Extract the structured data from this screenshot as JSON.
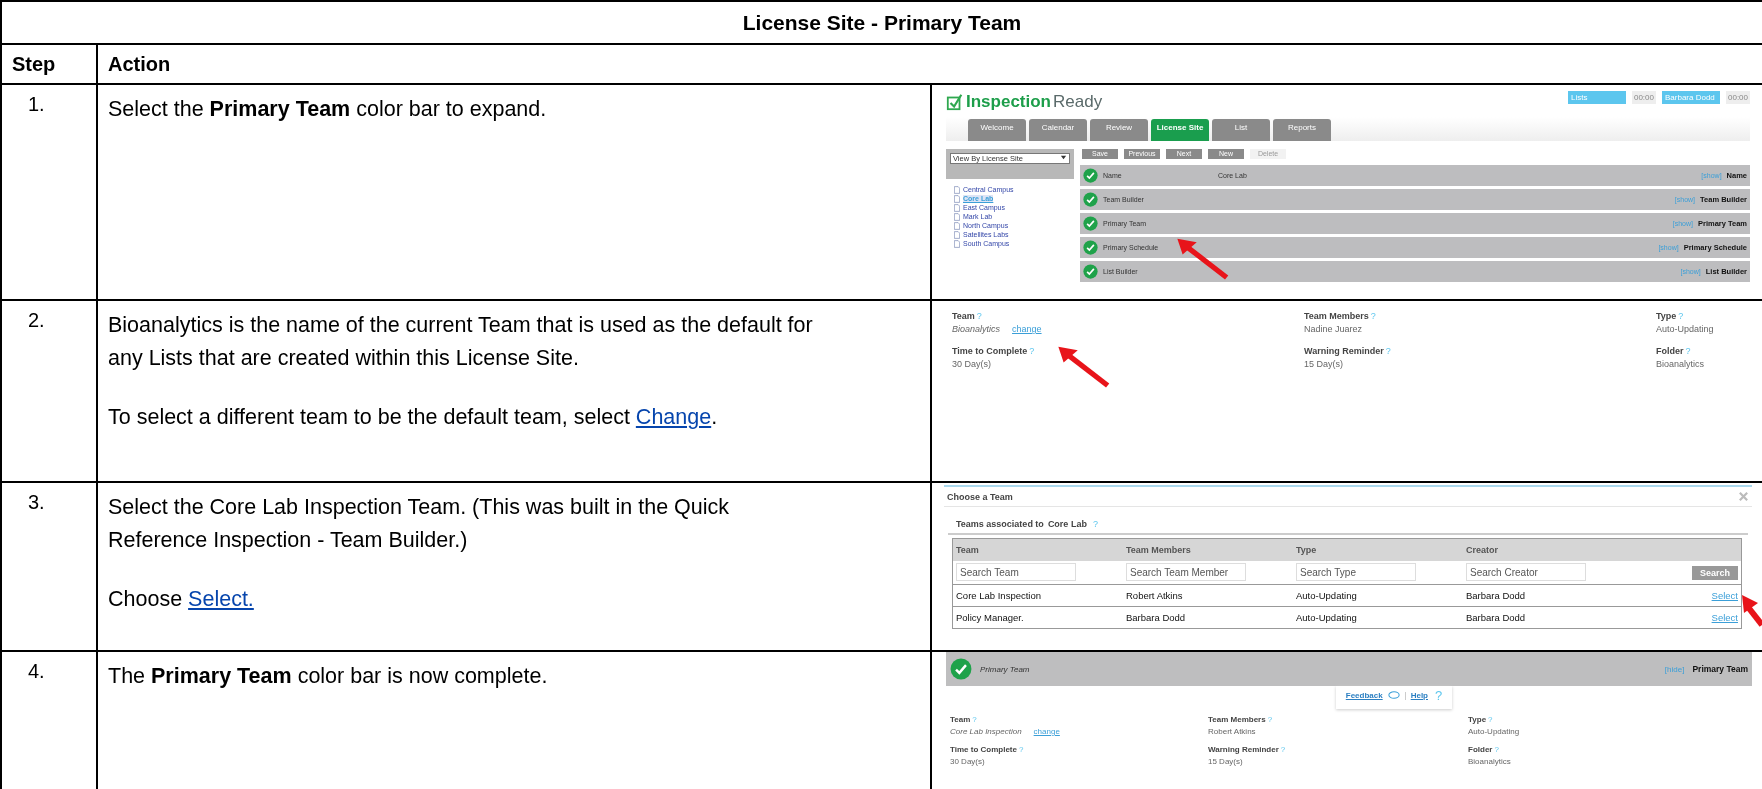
{
  "title": "License Site - Primary Team",
  "columns": [
    "Step",
    "Action"
  ],
  "steps": [
    {
      "number": "1.",
      "paragraphs": [
        {
          "text": "Select the **Primary Team** color bar to expand."
        }
      ],
      "screenshot": {
        "kind": "app",
        "logo_bold": "Inspection",
        "logo_light": "Ready",
        "top_pills": [
          {
            "label": "Lists",
            "time": "00:00"
          },
          {
            "label": "Barbara Dodd",
            "time": "00:00"
          }
        ],
        "tabs": [
          {
            "label": "Welcome",
            "selected": false
          },
          {
            "label": "Calendar",
            "selected": false
          },
          {
            "label": "Review",
            "selected": false
          },
          {
            "label": "License Site",
            "selected": true
          },
          {
            "label": "List",
            "selected": false
          },
          {
            "label": "Reports",
            "selected": false
          }
        ],
        "view_select": "View By License Site",
        "tree": [
          {
            "label": "Central Campus",
            "selected": false
          },
          {
            "label": "Core Lab",
            "selected": true
          },
          {
            "label": "East Campus",
            "selected": false
          },
          {
            "label": "Mark Lab",
            "selected": false
          },
          {
            "label": "North Campus",
            "selected": false
          },
          {
            "label": "Satellites Labs",
            "selected": false
          },
          {
            "label": "South Campus",
            "selected": false
          }
        ],
        "toolbar": [
          {
            "label": "Save",
            "disabled": false
          },
          {
            "label": "Previous",
            "disabled": false
          },
          {
            "label": "Next",
            "disabled": false
          },
          {
            "label": "New",
            "disabled": false
          },
          {
            "label": "Delete",
            "disabled": true
          }
        ],
        "bars": [
          {
            "label": "Name",
            "value": "Core Lab",
            "toggle": "[show]",
            "title": "Name"
          },
          {
            "label": "Team Builder",
            "toggle": "[show]",
            "title": "Team Builder"
          },
          {
            "label": "Primary Team",
            "toggle": "[show]",
            "title": "Primary Team"
          },
          {
            "label": "Primary Schedule",
            "toggle": "[show]",
            "title": "Primary Schedule"
          },
          {
            "label": "List Builder",
            "toggle": "[show]",
            "title": "List Builder"
          }
        ]
      }
    },
    {
      "number": "2.",
      "paragraphs": [
        {
          "text": "Bioanalytics is the name of the current Team that is used as the default for any Lists that are created within this License Site."
        },
        {
          "text": "To select a different team to be the default team, select ",
          "link": "Change",
          "after": "."
        }
      ],
      "screenshot": {
        "kind": "details",
        "fields": [
          {
            "label": "Team",
            "hint": "?",
            "value": "Bioanalytics",
            "link": "change"
          },
          {
            "label": "Team Members",
            "hint": "?",
            "value": "Nadine Juarez"
          },
          {
            "label": "Type",
            "hint": "?",
            "value": "Auto-Updating"
          },
          {
            "label": "Time to Complete",
            "hint": "?",
            "value": "30 Day(s)"
          },
          {
            "label": "Warning Reminder",
            "hint": "?",
            "value": "15 Day(s)"
          },
          {
            "label": "Folder",
            "hint": "?",
            "value": "Bioanalytics"
          }
        ]
      }
    },
    {
      "number": "3.",
      "paragraphs": [
        {
          "text": "Select the Core Lab Inspection Team.  (This was built in the Quick Reference Inspection - Team Builder.)"
        },
        {
          "text": "Choose ",
          "link": "Select."
        }
      ],
      "screenshot": {
        "kind": "chooser",
        "title": "Choose a Team",
        "subtitle": "Teams associated to",
        "site": "Core Lab",
        "hint": "?",
        "columns": [
          "Team",
          "Team Members",
          "Type",
          "Creator"
        ],
        "searches": [
          {
            "placeholder": "Search Team"
          },
          {
            "placeholder": "Search Team Member"
          },
          {
            "placeholder": "Search Type"
          },
          {
            "placeholder": "Search Creator"
          }
        ],
        "search_button": "Search",
        "rows": [
          {
            "cells": [
              "Core Lab Inspection",
              "Robert Atkins",
              "Auto-Updating",
              "Barbara Dodd"
            ],
            "action": "Select"
          },
          {
            "cells": [
              "Policy Manager.",
              "Barbara Dodd",
              "Auto-Updating",
              "Barbara Dodd"
            ],
            "action": "Select"
          }
        ]
      }
    },
    {
      "number": "4.",
      "paragraphs": [
        {
          "text": "The **Primary Team** color bar is now complete."
        }
      ],
      "screenshot": {
        "kind": "expanded",
        "bar_label": "Primary Team",
        "toggle": "[hide]",
        "bar_title": "Primary Team",
        "feedback": "Feedback",
        "help": "Help",
        "help_mark": "?",
        "fields": [
          {
            "label": "Team",
            "hint": "?",
            "value": "Core Lab Inspection",
            "link": "change"
          },
          {
            "label": "Team Members",
            "hint": "?",
            "value": "Robert Atkins"
          },
          {
            "label": "Type",
            "hint": "?",
            "value": "Auto-Updating"
          },
          {
            "label": "Time to Complete",
            "hint": "?",
            "value": "30 Day(s)"
          },
          {
            "label": "Warning Reminder",
            "hint": "?",
            "value": "15 Day(s)"
          },
          {
            "label": "Folder",
            "hint": "?",
            "value": "Bioanalytics"
          }
        ]
      }
    }
  ]
}
